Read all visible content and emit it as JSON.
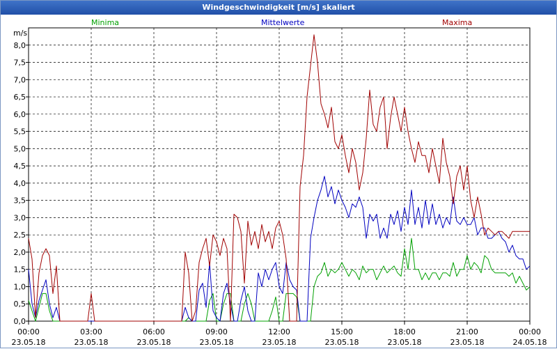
{
  "window": {
    "title": "Windgeschwindigkeit [m/s] skaliert"
  },
  "chart_data": {
    "type": "line",
    "ylabel": "m/s",
    "ylim": [
      0,
      8.5
    ],
    "xlim": [
      "2018-05-23 00:00",
      "2018-05-24 00:00"
    ],
    "y_ticks": [
      "0,0",
      "0,5",
      "1,0",
      "1,5",
      "2,0",
      "2,5",
      "3,0",
      "3,5",
      "4,0",
      "4,5",
      "5,0",
      "5,5",
      "6,0",
      "6,5",
      "7,0",
      "7,5",
      "8,0"
    ],
    "x_ticks": [
      {
        "time": "00:00",
        "date": "23.05.18"
      },
      {
        "time": "03:00",
        "date": "23.05.18"
      },
      {
        "time": "06:00",
        "date": "23.05.18"
      },
      {
        "time": "09:00",
        "date": "23.05.18"
      },
      {
        "time": "12:00",
        "date": "23.05.18"
      },
      {
        "time": "15:00",
        "date": "23.05.18"
      },
      {
        "time": "18:00",
        "date": "23.05.18"
      },
      {
        "time": "21:00",
        "date": "23.05.18"
      },
      {
        "time": "00:00",
        "date": "24.05.18"
      }
    ],
    "grid": true,
    "legend_position": "top",
    "series": [
      {
        "name": "Minima",
        "color": "#00a000",
        "x": [
          "00:00",
          "00:10",
          "00:20",
          "00:30",
          "00:40",
          "00:50",
          "01:00",
          "01:10",
          "01:20",
          "01:30",
          "07:20",
          "07:30",
          "07:40",
          "07:50",
          "08:00",
          "08:10",
          "08:20",
          "08:30",
          "08:40",
          "08:50",
          "09:00",
          "09:10",
          "09:20",
          "09:30",
          "09:40",
          "09:50",
          "10:00",
          "10:10",
          "10:20",
          "10:30",
          "10:40",
          "10:50",
          "11:00",
          "11:10",
          "11:20",
          "11:30",
          "11:40",
          "11:50",
          "12:00",
          "12:10",
          "12:20",
          "12:30",
          "12:40",
          "12:50",
          "13:00",
          "13:10",
          "13:20",
          "13:30",
          "13:40",
          "13:50",
          "14:00",
          "14:10",
          "14:20",
          "14:30",
          "14:40",
          "14:50",
          "15:00",
          "15:10",
          "15:20",
          "15:30",
          "15:40",
          "15:50",
          "16:00",
          "16:10",
          "16:20",
          "16:30",
          "16:40",
          "16:50",
          "17:00",
          "17:10",
          "17:20",
          "17:30",
          "17:40",
          "17:50",
          "18:00",
          "18:10",
          "18:20",
          "18:30",
          "18:40",
          "18:50",
          "19:00",
          "19:10",
          "19:20",
          "19:30",
          "19:40",
          "19:50",
          "20:00",
          "20:10",
          "20:20",
          "20:30",
          "20:40",
          "20:50",
          "21:00",
          "21:10",
          "21:20",
          "21:30",
          "21:40",
          "21:50",
          "22:00",
          "22:10",
          "22:20",
          "22:30",
          "22:40",
          "22:50",
          "23:00",
          "23:10",
          "23:20",
          "23:30",
          "23:40",
          "23:50",
          "24:00"
        ],
        "values": [
          0.6,
          0.3,
          0.0,
          0.4,
          0.8,
          0.8,
          0.3,
          0.0,
          0.0,
          0.0,
          0.0,
          0.0,
          0.1,
          0.0,
          0.0,
          0.0,
          0.0,
          0.0,
          0.6,
          0.8,
          0.0,
          0.0,
          0.5,
          0.8,
          0.8,
          0.0,
          0.0,
          0.0,
          0.5,
          0.8,
          0.5,
          0.0,
          0.0,
          0.0,
          0.0,
          0.0,
          0.3,
          0.7,
          0.0,
          0.0,
          0.8,
          0.8,
          0.8,
          0.7,
          0.0,
          0.0,
          0.0,
          0.0,
          1.0,
          1.3,
          1.4,
          1.7,
          1.3,
          1.5,
          1.4,
          1.5,
          1.7,
          1.5,
          1.3,
          1.5,
          1.4,
          1.2,
          1.6,
          1.4,
          1.5,
          1.5,
          1.2,
          1.4,
          1.6,
          1.4,
          1.5,
          1.6,
          1.4,
          1.3,
          2.1,
          1.5,
          2.4,
          1.5,
          1.5,
          1.2,
          1.4,
          1.2,
          1.4,
          1.4,
          1.2,
          1.4,
          1.4,
          1.3,
          1.7,
          1.3,
          1.5,
          1.5,
          1.9,
          1.5,
          1.7,
          1.6,
          1.4,
          1.9,
          1.8,
          1.5,
          1.4,
          1.4,
          1.4,
          1.4,
          1.3,
          1.4,
          1.1,
          1.3,
          1.1,
          0.9,
          1.0
        ]
      },
      {
        "name": "Mittelwerte",
        "color": "#0000c0",
        "x": [
          "00:00",
          "00:10",
          "00:20",
          "00:30",
          "00:40",
          "00:50",
          "01:00",
          "01:10",
          "01:20",
          "01:30",
          "07:20",
          "07:30",
          "07:40",
          "07:50",
          "08:00",
          "08:10",
          "08:20",
          "08:30",
          "08:40",
          "08:50",
          "09:00",
          "09:10",
          "09:20",
          "09:30",
          "09:40",
          "09:50",
          "10:00",
          "10:10",
          "10:20",
          "10:30",
          "10:40",
          "10:50",
          "11:00",
          "11:10",
          "11:20",
          "11:30",
          "11:40",
          "11:50",
          "12:00",
          "12:10",
          "12:20",
          "12:30",
          "12:40",
          "12:50",
          "13:00",
          "13:10",
          "13:20",
          "13:30",
          "13:40",
          "13:50",
          "14:00",
          "14:10",
          "14:20",
          "14:30",
          "14:40",
          "14:50",
          "15:00",
          "15:10",
          "15:20",
          "15:30",
          "15:40",
          "15:50",
          "16:00",
          "16:10",
          "16:20",
          "16:30",
          "16:40",
          "16:50",
          "17:00",
          "17:10",
          "17:20",
          "17:30",
          "17:40",
          "17:50",
          "18:00",
          "18:10",
          "18:20",
          "18:30",
          "18:40",
          "18:50",
          "19:00",
          "19:10",
          "19:20",
          "19:30",
          "19:40",
          "19:50",
          "20:00",
          "20:10",
          "20:20",
          "20:30",
          "20:40",
          "20:50",
          "21:00",
          "21:10",
          "21:20",
          "21:30",
          "21:40",
          "21:50",
          "22:00",
          "22:10",
          "22:20",
          "22:30",
          "22:40",
          "22:50",
          "23:00",
          "23:10",
          "23:20",
          "23:30",
          "23:40",
          "23:50",
          "24:00"
        ],
        "values": [
          1.5,
          0.5,
          0.1,
          0.6,
          0.9,
          1.2,
          0.5,
          0.1,
          0.4,
          0.0,
          0.0,
          0.4,
          0.1,
          0.0,
          0.0,
          0.9,
          1.1,
          0.4,
          1.7,
          0.3,
          0.1,
          0.0,
          0.8,
          1.1,
          0.5,
          0.0,
          0.0,
          0.6,
          1.0,
          0.3,
          0.0,
          0.0,
          1.4,
          1.0,
          1.5,
          1.2,
          1.5,
          1.7,
          1.0,
          0.8,
          1.7,
          1.2,
          1.0,
          0.9,
          0.0,
          0.0,
          0.0,
          2.4,
          3.0,
          3.5,
          3.8,
          4.2,
          3.6,
          3.9,
          3.4,
          3.8,
          3.5,
          3.3,
          3.0,
          3.4,
          3.3,
          3.6,
          3.3,
          2.4,
          3.1,
          2.9,
          3.1,
          2.4,
          2.7,
          2.4,
          3.1,
          2.8,
          3.2,
          2.6,
          3.3,
          2.8,
          3.8,
          2.8,
          3.3,
          2.7,
          3.5,
          2.8,
          3.4,
          2.8,
          3.1,
          2.7,
          3.0,
          2.8,
          3.6,
          2.9,
          2.8,
          3.0,
          2.8,
          2.8,
          3.0,
          2.5,
          2.7,
          2.7,
          2.4,
          2.4,
          2.5,
          2.6,
          2.4,
          2.3,
          2.0,
          2.2,
          1.9,
          1.8,
          1.8,
          1.5,
          1.6
        ]
      },
      {
        "name": "Maxima",
        "color": "#a00000",
        "x": [
          "00:00",
          "00:10",
          "00:20",
          "00:30",
          "00:40",
          "00:50",
          "01:00",
          "01:10",
          "01:20",
          "01:30",
          "02:50",
          "03:00",
          "03:10",
          "07:20",
          "07:30",
          "07:40",
          "07:50",
          "08:00",
          "08:10",
          "08:20",
          "08:30",
          "08:40",
          "08:50",
          "09:00",
          "09:10",
          "09:20",
          "09:30",
          "09:40",
          "09:50",
          "10:00",
          "10:10",
          "10:20",
          "10:30",
          "10:40",
          "10:50",
          "11:00",
          "11:10",
          "11:20",
          "11:30",
          "11:40",
          "11:50",
          "12:00",
          "12:10",
          "12:20",
          "12:30",
          "12:40",
          "12:50",
          "13:00",
          "13:10",
          "13:20",
          "13:30",
          "13:40",
          "13:50",
          "14:00",
          "14:10",
          "14:20",
          "14:30",
          "14:40",
          "14:50",
          "15:00",
          "15:10",
          "15:20",
          "15:30",
          "15:40",
          "15:50",
          "16:00",
          "16:10",
          "16:20",
          "16:30",
          "16:40",
          "16:50",
          "17:00",
          "17:10",
          "17:20",
          "17:30",
          "17:40",
          "17:50",
          "18:00",
          "18:10",
          "18:20",
          "18:30",
          "18:40",
          "18:50",
          "19:00",
          "19:10",
          "19:20",
          "19:30",
          "19:40",
          "19:50",
          "20:00",
          "20:10",
          "20:20",
          "20:30",
          "20:40",
          "20:50",
          "21:00",
          "21:10",
          "21:20",
          "21:30",
          "21:40",
          "21:50",
          "22:00",
          "22:10",
          "22:20",
          "22:30",
          "22:40",
          "22:50",
          "23:00",
          "23:10",
          "23:20",
          "23:30",
          "23:40",
          "23:50",
          "24:00"
        ],
        "values": [
          2.4,
          1.8,
          0.1,
          1.4,
          1.9,
          2.1,
          1.9,
          0.8,
          1.6,
          0.0,
          0.0,
          0.8,
          0.0,
          0.0,
          2.0,
          1.4,
          0.0,
          0.3,
          1.7,
          2.1,
          2.4,
          1.6,
          2.5,
          2.3,
          1.9,
          2.4,
          2.1,
          0.0,
          3.1,
          3.0,
          2.6,
          1.1,
          2.9,
          2.2,
          2.6,
          2.1,
          2.8,
          2.3,
          2.6,
          2.1,
          2.7,
          2.9,
          2.5,
          1.8,
          0.0,
          0.0,
          0.0,
          3.9,
          4.8,
          6.5,
          7.4,
          8.3,
          7.5,
          6.3,
          6.0,
          5.6,
          6.2,
          5.2,
          5.0,
          5.4,
          4.8,
          4.3,
          5.0,
          4.6,
          3.8,
          4.3,
          5.3,
          6.7,
          5.7,
          5.5,
          6.2,
          6.5,
          5.0,
          5.9,
          6.5,
          6.0,
          5.5,
          6.2,
          5.5,
          5.0,
          4.6,
          5.2,
          4.8,
          4.8,
          4.3,
          5.0,
          4.5,
          4.0,
          5.3,
          4.6,
          4.2,
          3.4,
          4.2,
          4.5,
          3.8,
          4.5,
          3.5,
          3.0,
          3.6,
          3.1,
          2.5,
          2.7,
          2.6,
          2.5,
          2.6,
          2.6,
          2.5,
          2.4,
          2.6,
          2.6,
          2.6,
          2.6,
          2.6,
          2.6
        ]
      }
    ]
  }
}
